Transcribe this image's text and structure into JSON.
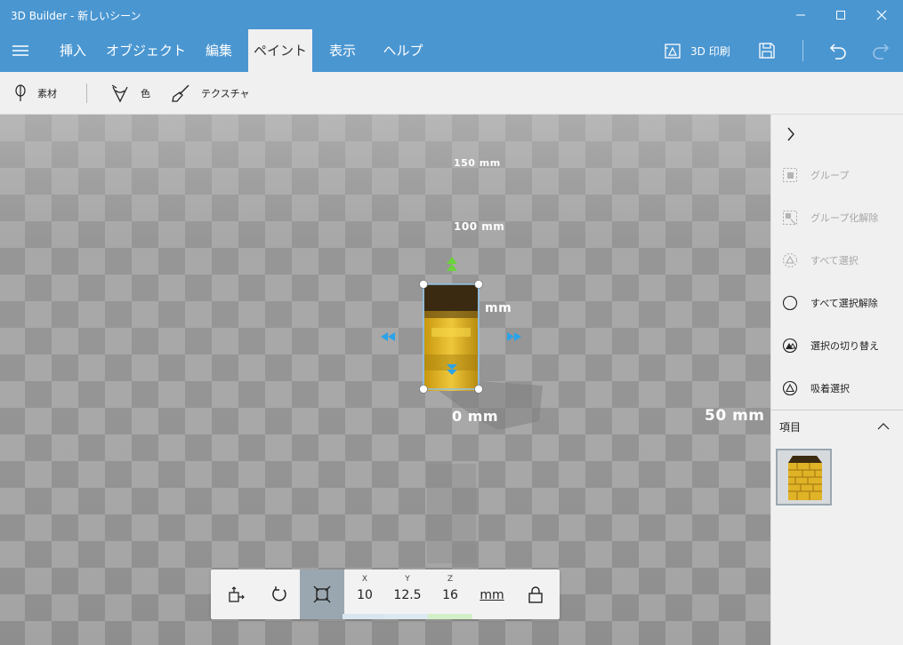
{
  "window": {
    "title": "3D Builder - 新しいシーン"
  },
  "menu": {
    "tabs": [
      {
        "label": "挿入"
      },
      {
        "label": "オブジェクト"
      },
      {
        "label": "編集"
      },
      {
        "label": "ペイント"
      },
      {
        "label": "表示"
      },
      {
        "label": "ヘルプ"
      }
    ],
    "active_tab": "ペイント",
    "print_label": "3D 印刷"
  },
  "toolbar": {
    "material_label": "素材",
    "color_label": "色",
    "texture_label": "テクスチャ"
  },
  "viewport": {
    "scale_labels": [
      "150 mm",
      "100 mm",
      "mm",
      "0 mm",
      "50 mm"
    ]
  },
  "transform": {
    "x_label": "X",
    "y_label": "Y",
    "z_label": "Z",
    "x_value": "10",
    "y_value": "12.5",
    "z_value": "16",
    "unit": "mm"
  },
  "right_panel": {
    "actions": [
      {
        "label": "グループ",
        "enabled": false
      },
      {
        "label": "グループ化解除",
        "enabled": false
      },
      {
        "label": "すべて選択",
        "enabled": false
      },
      {
        "label": "すべて選択解除",
        "enabled": true
      },
      {
        "label": "選択の切り替え",
        "enabled": true
      },
      {
        "label": "吸着選択",
        "enabled": true
      }
    ],
    "items_header": "項目"
  },
  "colors": {
    "accent": "#4a96d1",
    "object_yellow": "#e2b824",
    "selection": "#8fc3ea",
    "arrow_blue": "#2aa3e8",
    "arrow_green": "#6ad43a"
  }
}
